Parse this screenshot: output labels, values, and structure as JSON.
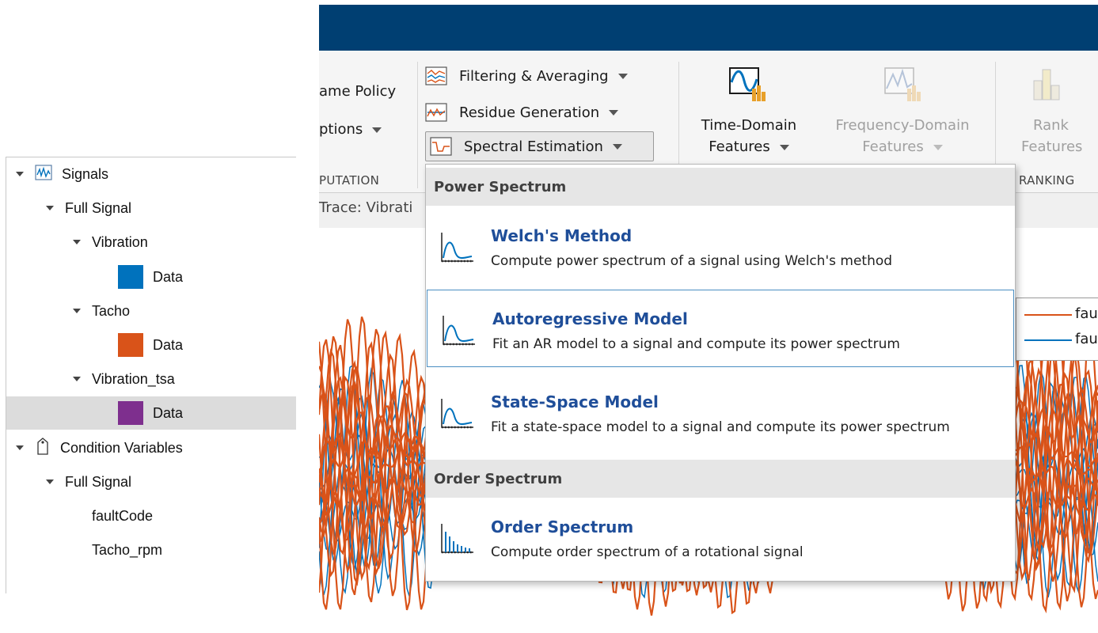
{
  "tree": {
    "items": [
      {
        "label": "Signals",
        "level": 0,
        "icon": "signal-icon"
      },
      {
        "label": "Full Signal",
        "level": 1
      },
      {
        "label": "Vibration",
        "level": 2
      },
      {
        "label": "Data",
        "level": 3,
        "color": "#0072bd"
      },
      {
        "label": "Tacho",
        "level": 2
      },
      {
        "label": "Data",
        "level": 3,
        "color": "#d95319"
      },
      {
        "label": "Vibration_tsa",
        "level": 2
      },
      {
        "label": "Data",
        "level": 3,
        "color": "#7e2f8e",
        "selected": true
      },
      {
        "label": "Condition Variables",
        "level": 0,
        "icon": "tag-icon"
      },
      {
        "label": "Full Signal",
        "level": 1
      },
      {
        "label": "faultCode",
        "level": 2
      },
      {
        "label": "Tacho_rpm",
        "level": 2
      }
    ]
  },
  "toolstrip": {
    "frame_policy": "ame Policy",
    "options": "ptions",
    "computation_section": "PUTATION",
    "filtering": "Filtering & Averaging",
    "residue": "Residue Generation",
    "spectral": "Spectral Estimation",
    "time_domain_1": "Time-Domain",
    "time_domain_2": "Features",
    "freq_domain_1": "Frequency-Domain",
    "freq_domain_2": "Features",
    "rank_1": "Rank",
    "rank_2": "Features",
    "ranking_section": "RANKING",
    "trace_label": "Trace: Vibrati"
  },
  "legend": {
    "entry1": "fau",
    "entry2": "fau"
  },
  "menu": {
    "power_spectrum_header": "Power Spectrum",
    "order_spectrum_header": "Order Spectrum",
    "items": [
      {
        "title": "Welch's Method",
        "desc": "Compute power spectrum of a signal using Welch's method"
      },
      {
        "title": "Autoregressive Model",
        "desc": "Fit an AR model to a signal and compute its power spectrum"
      },
      {
        "title": "State-Space Model",
        "desc": "Fit a state-space model to a signal and compute its power spectrum"
      },
      {
        "title": "Order Spectrum",
        "desc": "Compute order spectrum of a rotational signal"
      }
    ]
  },
  "colors": {
    "header": "#003f72",
    "series_orange": "#d95319",
    "series_blue": "#0072bd",
    "menu_title": "#1f4e99"
  }
}
